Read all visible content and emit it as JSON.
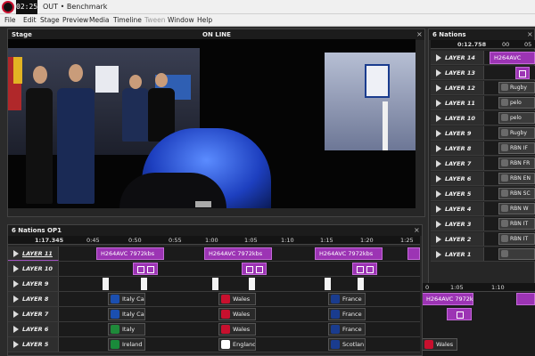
{
  "titlebar": {
    "clock": "02:25",
    "title": "OUT • Benchmark"
  },
  "menu": [
    "File",
    "Edit",
    "Stage",
    "Preview",
    "Media",
    "Timeline",
    "Tween",
    "Window",
    "Help"
  ],
  "menu_disabled": [
    "Tween"
  ],
  "stage": {
    "title": "Stage",
    "status": "ON LINE"
  },
  "right_panel": {
    "title": "6 Nations",
    "time": "0:12.758",
    "ticks": [
      "00",
      "05"
    ],
    "layers": [
      {
        "name": "LAYER 14",
        "clip": "H264AVC",
        "clip_type": "purple"
      },
      {
        "name": "LAYER 13",
        "clip": "",
        "clip_type": "purple-mini"
      },
      {
        "name": "LAYER 12",
        "clip": "Rugby",
        "clip_type": "thumb"
      },
      {
        "name": "LAYER 11",
        "clip": "pelo",
        "clip_type": "thumb"
      },
      {
        "name": "LAYER 10",
        "clip": "pelo",
        "clip_type": "thumb"
      },
      {
        "name": "LAYER 9",
        "clip": "Rugby",
        "clip_type": "thumb"
      },
      {
        "name": "LAYER 8",
        "clip": "RBN IF",
        "clip_type": "thumb"
      },
      {
        "name": "LAYER 7",
        "clip": "RBN FR",
        "clip_type": "thumb"
      },
      {
        "name": "LAYER 6",
        "clip": "RBN EN",
        "clip_type": "thumb"
      },
      {
        "name": "LAYER 5",
        "clip": "RBN SC",
        "clip_type": "thumb"
      },
      {
        "name": "LAYER 4",
        "clip": "RBN W",
        "clip_type": "thumb"
      },
      {
        "name": "LAYER 3",
        "clip": "RBN IT",
        "clip_type": "thumb"
      },
      {
        "name": "LAYER 2",
        "clip": "RBN IT",
        "clip_type": "thumb"
      },
      {
        "name": "LAYER 1",
        "clip": "",
        "clip_type": "thumb"
      }
    ],
    "bottom_ticks": [
      "0",
      "1:05",
      "1:10"
    ],
    "bottom_clips": [
      {
        "label": "H264AVC 7972kbs",
        "type": "purple"
      },
      {
        "label": "",
        "type": "purple-mini"
      },
      {
        "label": "",
        "type": "empty"
      },
      {
        "label": "",
        "type": "empty"
      },
      {
        "label": "Wales",
        "type": "nation"
      }
    ]
  },
  "timeline": {
    "title": "6 Nations OP1",
    "time": "1:17.345",
    "ticks": [
      "0:45",
      "0:50",
      "0:55",
      "1:00",
      "1:05",
      "1:10",
      "1:15",
      "1:20",
      "1:25"
    ],
    "clip_label": "H264AVC 7972kbs",
    "layers": [
      {
        "name": "LAYER 11",
        "selected": true
      },
      {
        "name": "LAYER 10"
      },
      {
        "name": "LAYER 9"
      },
      {
        "name": "LAYER 8"
      },
      {
        "name": "LAYER 7"
      },
      {
        "name": "LAYER 6"
      },
      {
        "name": "LAYER 5"
      }
    ],
    "nations": {
      "LAYER 8": [
        "Italy Ca",
        "Wales",
        "France"
      ],
      "LAYER 7": [
        "Italy Ca",
        "Wales",
        "France"
      ],
      "LAYER 6": [
        "Italy",
        "Wales",
        "France"
      ],
      "LAYER 5": [
        "Ireland",
        "England",
        "Scotlan"
      ]
    }
  },
  "colors": {
    "clip": "#9c34b4",
    "accent": "#c8102e",
    "stage_blue": "#2f6bff"
  }
}
